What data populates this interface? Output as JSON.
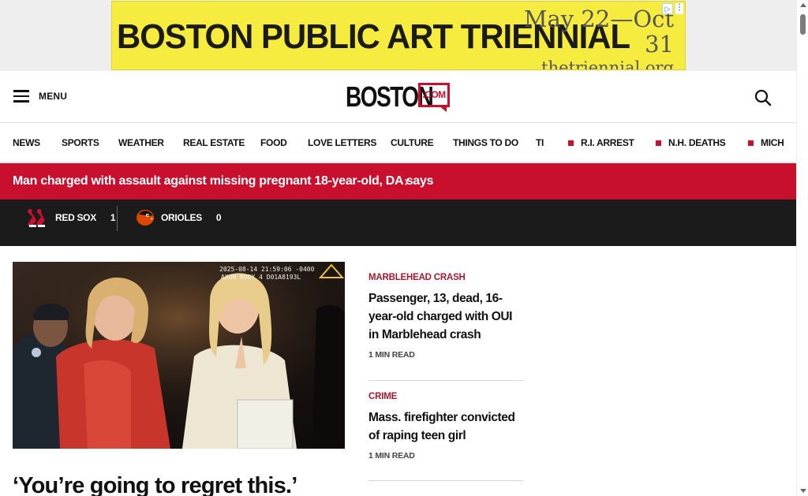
{
  "ad": {
    "headline": "BOSTON PUBLIC ART TRIENNIAL",
    "dates": "May 22—Oct 31",
    "url": "thetriennial.org"
  },
  "header": {
    "menu_label": "MENU",
    "logo_word": "BOSTON",
    "logo_suffix": ".COM"
  },
  "nav": {
    "items": [
      "NEWS",
      "SPORTS",
      "WEATHER",
      "REAL ESTATE",
      "FOOD",
      "LOVE LETTERS",
      "CULTURE",
      "THINGS TO DO",
      "TI"
    ],
    "trending": [
      "R.I. ARREST",
      "N.H. DEATHS",
      "MICH"
    ]
  },
  "breaking": {
    "text": "Man charged with assault against missing pregnant 18-year-old, DA says"
  },
  "scores": {
    "home": {
      "name": "RED SOX",
      "score": "1"
    },
    "away": {
      "name": "ORIOLES",
      "score": "0"
    }
  },
  "hero": {
    "bodycam_timestamp": "2025-08-14 21:59:06 -0400",
    "bodycam_device": "AXON BODY 4 D01A8193L",
    "headline": "‘You’re going to regret this.’"
  },
  "stories": [
    {
      "category": "MARBLEHEAD CRASH",
      "title": "Passenger, 13, dead, 16-year-old charged with OUI in Marblehead crash",
      "meta": "1 MIN READ"
    },
    {
      "category": "CRIME",
      "title": "Mass. firefighter convicted of raping teen girl",
      "meta": "1 MIN READ"
    }
  ],
  "colors": {
    "brand_red": "#c8102e",
    "category_red": "#a6192e",
    "ad_yellow": "#f6ec3f",
    "scores_bg": "#1b1b1b"
  },
  "icons": {
    "menu": "hamburger-icon",
    "search": "search-icon",
    "ad_choices": "adchoices-icon"
  }
}
